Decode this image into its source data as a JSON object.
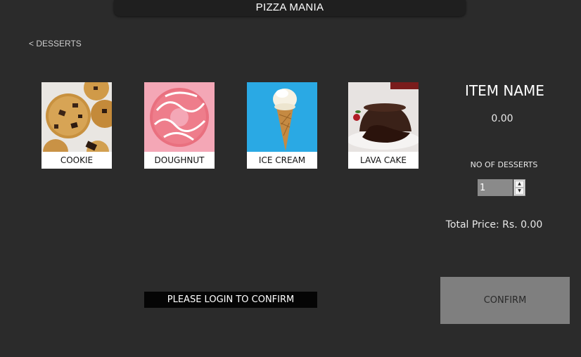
{
  "window": {
    "title": "PIZZA MANIA"
  },
  "nav": {
    "back_label": "< DESSERTS"
  },
  "desserts": [
    {
      "label": "COOKIE",
      "image": "cookie-image"
    },
    {
      "label": "DOUGHNUT",
      "image": "doughnut-image"
    },
    {
      "label": "ICE CREAM",
      "image": "ice-cream-image"
    },
    {
      "label": "LAVA CAKE",
      "image": "lava-cake-image"
    }
  ],
  "details": {
    "item_name": "ITEM NAME",
    "price": "0.00",
    "qty_label": "NO OF DESSERTS",
    "qty_value": "1",
    "total_label": "Total Price: Rs. 0.00"
  },
  "footer": {
    "login_message": "PLEASE LOGIN TO CONFIRM",
    "confirm_label": "CONFIRM"
  },
  "colors": {
    "background": "#2b2b2b",
    "title_bar": "#1f1f1f",
    "confirm_button": "#7f7f7f",
    "login_banner": "#050505"
  }
}
